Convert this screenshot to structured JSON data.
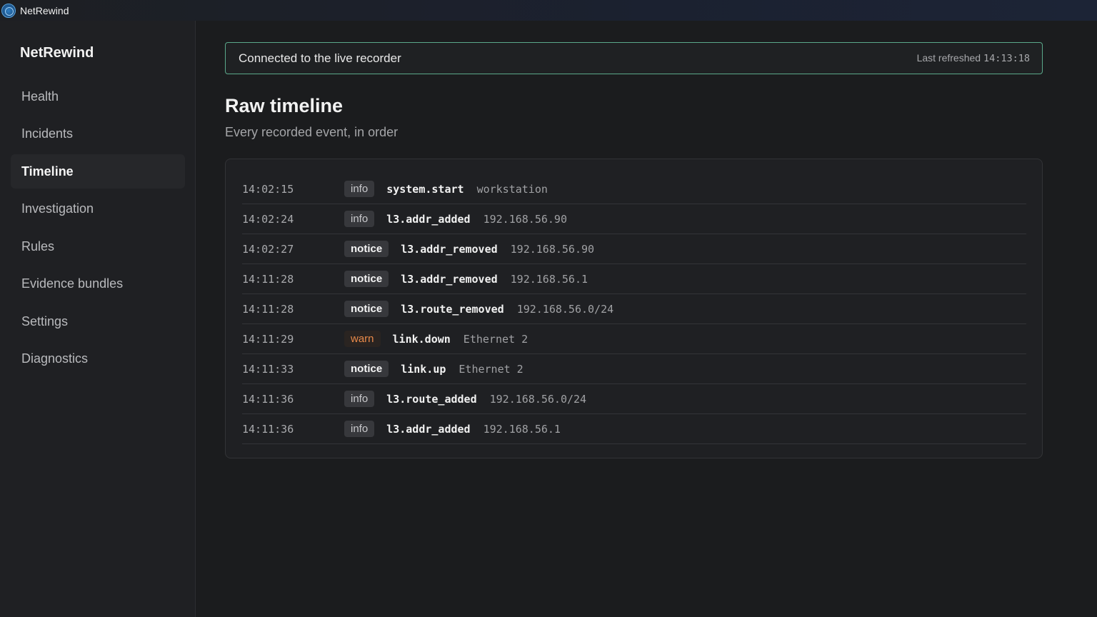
{
  "window": {
    "title": "NetRewind"
  },
  "sidebar": {
    "brand": "NetRewind",
    "items": [
      {
        "label": "Health",
        "active": false
      },
      {
        "label": "Incidents",
        "active": false
      },
      {
        "label": "Timeline",
        "active": true
      },
      {
        "label": "Investigation",
        "active": false
      },
      {
        "label": "Rules",
        "active": false
      },
      {
        "label": "Evidence bundles",
        "active": false
      },
      {
        "label": "Settings",
        "active": false
      },
      {
        "label": "Diagnostics",
        "active": false
      }
    ]
  },
  "status": {
    "connection": "Connected to the live recorder",
    "refreshed_label": "Last refreshed",
    "refreshed_time": "14:13:18"
  },
  "page": {
    "title": "Raw timeline",
    "subtitle": "Every recorded event, in order"
  },
  "events": [
    {
      "time": "14:02:15",
      "level": "info",
      "event": "system.start",
      "detail": "workstation"
    },
    {
      "time": "14:02:24",
      "level": "info",
      "event": "l3.addr_added",
      "detail": "192.168.56.90"
    },
    {
      "time": "14:02:27",
      "level": "notice",
      "event": "l3.addr_removed",
      "detail": "192.168.56.90"
    },
    {
      "time": "14:11:28",
      "level": "notice",
      "event": "l3.addr_removed",
      "detail": "192.168.56.1"
    },
    {
      "time": "14:11:28",
      "level": "notice",
      "event": "l3.route_removed",
      "detail": "192.168.56.0/24"
    },
    {
      "time": "14:11:29",
      "level": "warn",
      "event": "link.down",
      "detail": "Ethernet 2"
    },
    {
      "time": "14:11:33",
      "level": "notice",
      "event": "link.up",
      "detail": "Ethernet 2"
    },
    {
      "time": "14:11:36",
      "level": "info",
      "event": "l3.route_added",
      "detail": "192.168.56.0/24"
    },
    {
      "time": "14:11:36",
      "level": "info",
      "event": "l3.addr_added",
      "detail": "192.168.56.1"
    }
  ],
  "colors": {
    "accent_border": "#5aa88a",
    "warn": "#e98a4a",
    "background": "#1b1c1e"
  }
}
